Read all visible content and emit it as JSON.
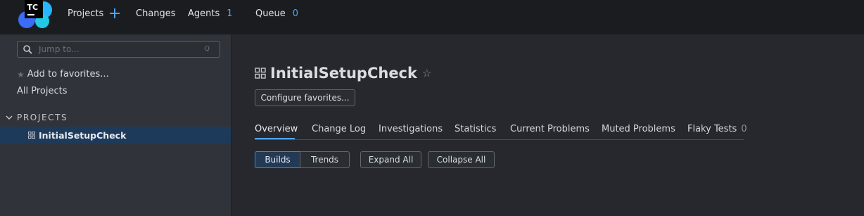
{
  "app": {
    "logo_text": "TC",
    "colors": {
      "accent": "#4da3ff",
      "topbar_bg": "#1b1c1f",
      "sidebar_bg": "#30343a",
      "main_bg": "#26282d",
      "selected_bg": "#1e3a5a"
    }
  },
  "topnav": {
    "projects_label": "Projects",
    "changes_label": "Changes",
    "agents_label": "Agents",
    "agents_count": "1",
    "queue_label": "Queue",
    "queue_count": "0"
  },
  "sidebar": {
    "search_placeholder": "Jump to...",
    "search_shortcut": "Q",
    "add_favorites_label": "Add to favorites...",
    "all_projects_label": "All Projects",
    "projects_heading": "PROJECTS",
    "project_items": [
      {
        "label": "InitialSetupCheck",
        "selected": true
      }
    ]
  },
  "main": {
    "title": "InitialSetupCheck",
    "configure_favorites_label": "Configure favorites...",
    "tabs": [
      {
        "label": "Overview",
        "active": true
      },
      {
        "label": "Change Log"
      },
      {
        "label": "Investigations"
      },
      {
        "label": "Statistics"
      },
      {
        "label": "Current Problems"
      },
      {
        "label": "Muted Problems"
      },
      {
        "label": "Flaky Tests",
        "count": "0"
      }
    ],
    "view_toggle": {
      "builds_label": "Builds",
      "trends_label": "Trends",
      "selected": "Builds"
    },
    "expand_all_label": "Expand All",
    "collapse_all_label": "Collapse All"
  }
}
